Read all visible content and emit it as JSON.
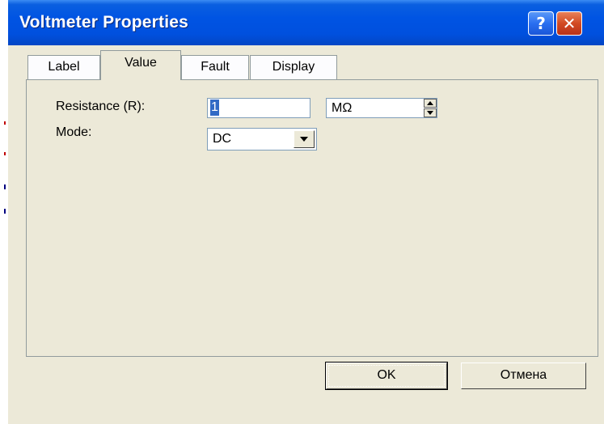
{
  "window": {
    "title": "Voltmeter Properties",
    "help_glyph": "?",
    "close_glyph": "✕"
  },
  "tabs": [
    {
      "label": "Label",
      "active": false
    },
    {
      "label": "Value",
      "active": true
    },
    {
      "label": "Fault",
      "active": false
    },
    {
      "label": "Display",
      "active": false
    }
  ],
  "value_tab": {
    "resistance": {
      "label": "Resistance (R):",
      "value": "1",
      "unit": "MΩ"
    },
    "mode": {
      "label": "Mode:",
      "selected": "DC"
    }
  },
  "buttons": {
    "ok_label": "OK",
    "cancel_label": "Отмена"
  },
  "colors": {
    "titlebar": "#0054e3",
    "dialog_bg": "#ece9d8",
    "selection": "#316ac5",
    "close_button": "#d24a22"
  }
}
